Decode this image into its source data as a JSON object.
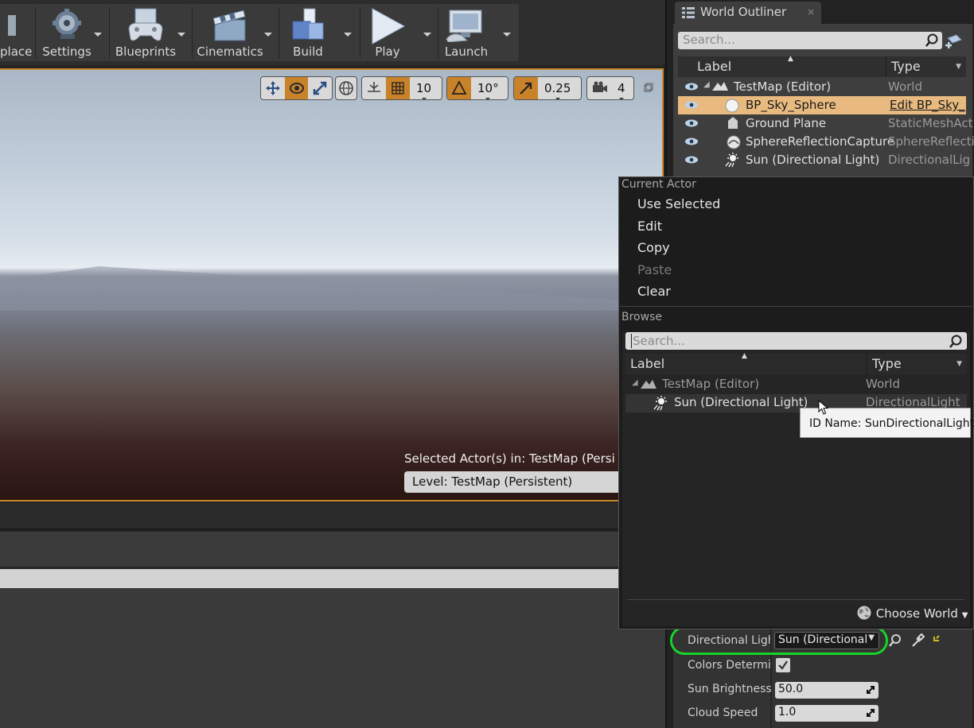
{
  "toolbar": {
    "items": [
      {
        "label": "place",
        "icon": "marketplace-icon"
      },
      {
        "label": "Settings",
        "icon": "settings-gear-icon"
      },
      {
        "label": "Blueprints",
        "icon": "blueprints-gamepad-icon"
      },
      {
        "label": "Cinematics",
        "icon": "clapperboard-icon"
      },
      {
        "label": "Build",
        "icon": "build-blocks-icon"
      },
      {
        "label": "Play",
        "icon": "play-triangle-icon"
      },
      {
        "label": "Launch",
        "icon": "launch-monitor-icon"
      }
    ]
  },
  "viewport": {
    "grid_snap": "10",
    "rotation_snap": "10°",
    "scale_snap": "0.25",
    "camera_speed": "4",
    "selected_actors_text": "Selected Actor(s) in:  TestMap (Persi",
    "level_text": "Level:  TestMap (Persistent)"
  },
  "outliner": {
    "tab_title": "World Outliner",
    "search_placeholder": "Search...",
    "col_label": "Label",
    "col_type": "Type",
    "rows": [
      {
        "label": "TestMap (Editor)",
        "type": "World"
      },
      {
        "label": "BP_Sky_Sphere",
        "type": "Edit BP_Sky_"
      },
      {
        "label": "Ground Plane",
        "type": "StaticMeshAct"
      },
      {
        "label": "SphereReflectionCapture",
        "type": "SphereReflecti"
      },
      {
        "label": "Sun (Directional Light)",
        "type": "DirectionalLig"
      }
    ]
  },
  "popup": {
    "current_actor_header": "Current Actor",
    "items": [
      "Use Selected",
      "Edit",
      "Copy",
      "Paste",
      "Clear"
    ],
    "browse_header": "Browse",
    "search_placeholder": "Search...",
    "col_label": "Label",
    "col_type": "Type",
    "rows": [
      {
        "label": "TestMap (Editor)",
        "type": "World"
      },
      {
        "label": "Sun (Directional Light)",
        "type": "DirectionalLight"
      }
    ],
    "choose_world": "Choose World",
    "tooltip": "ID Name: SunDirectionalLight"
  },
  "details": {
    "directional_light_label": "Directional Ligh",
    "directional_light_value": "Sun (Directional",
    "colors_label": "Colors Determin",
    "sun_brightness_label": "Sun Brightness",
    "sun_brightness_value": "50.0",
    "cloud_speed_label": "Cloud Speed",
    "cloud_speed_value": "1.0"
  }
}
